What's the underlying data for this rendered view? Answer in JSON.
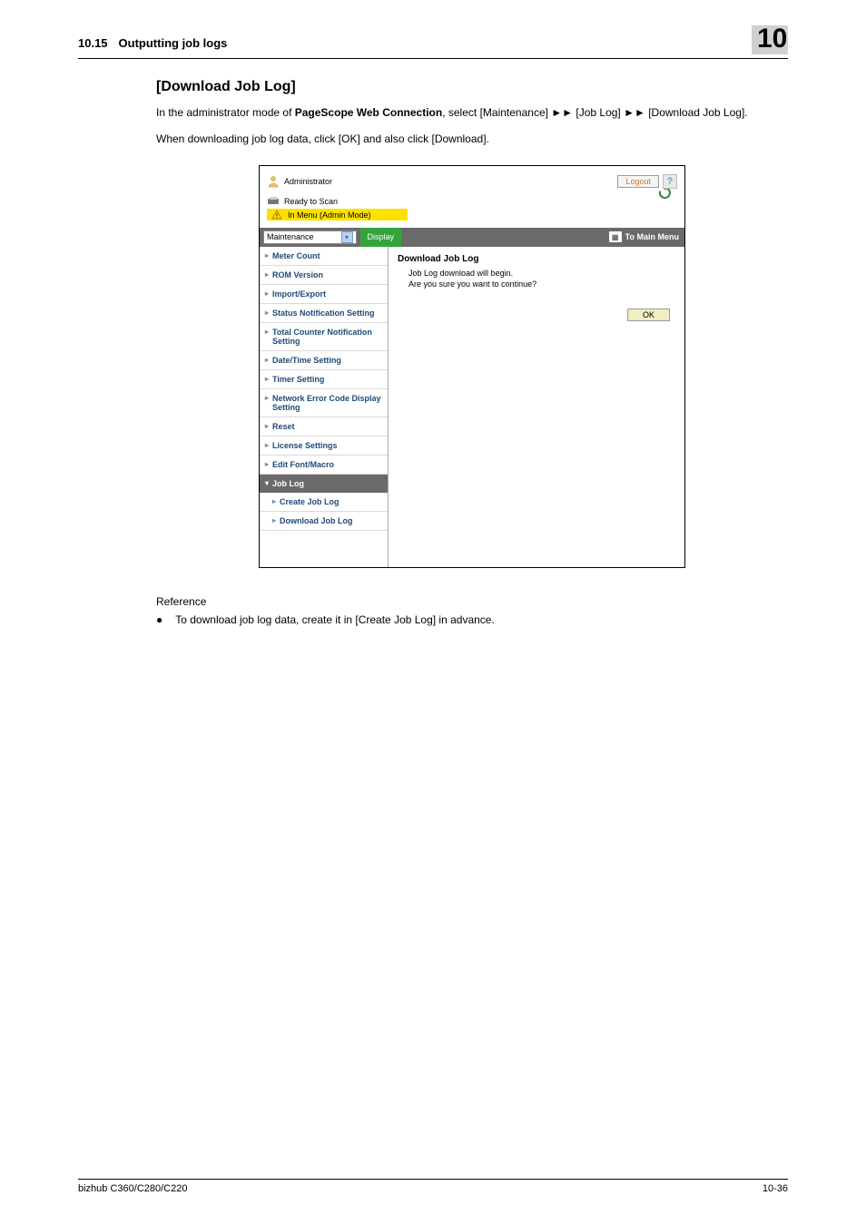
{
  "header": {
    "section_number": "10.15",
    "section_title": "Outputting job logs",
    "chapter": "10"
  },
  "body": {
    "h3": "[Download Job Log]",
    "p1_a": "In the administrator mode of ",
    "p1_bold": "PageScope Web Connection",
    "p1_b": ", select [Maintenance] ",
    "arrow": "►►",
    "p1_c": " [Job Log] ",
    "p1_d": " [Download Job Log].",
    "p2": "When downloading job log data, click [OK] and also click [Download].",
    "reference_label": "Reference",
    "bullet1": "To download job log data, create it in [Create Job Log] in advance."
  },
  "screenshot": {
    "admin_label": "Administrator",
    "logout": "Logout",
    "help": "?",
    "status1": "Ready to Scan",
    "status2": "In Menu (Admin Mode)",
    "select_value": "Maintenance",
    "display_btn": "Display",
    "to_main": "To Main Menu",
    "side": [
      "Meter Count",
      "ROM Version",
      "Import/Export",
      "Status Notification Setting",
      "Total Counter Notification Setting",
      "Date/Time Setting",
      "Timer Setting",
      "Network Error Code Display Setting",
      "Reset",
      "License Settings",
      "Edit Font/Macro"
    ],
    "side_group": "Job Log",
    "side_sub": [
      "Create Job Log",
      "Download Job Log"
    ],
    "main_title": "Download Job Log",
    "main_msg1": "Job Log download will begin.",
    "main_msg2": "Are you sure you want to continue?",
    "ok": "OK"
  },
  "footer": {
    "left": "bizhub C360/C280/C220",
    "right": "10-36"
  }
}
